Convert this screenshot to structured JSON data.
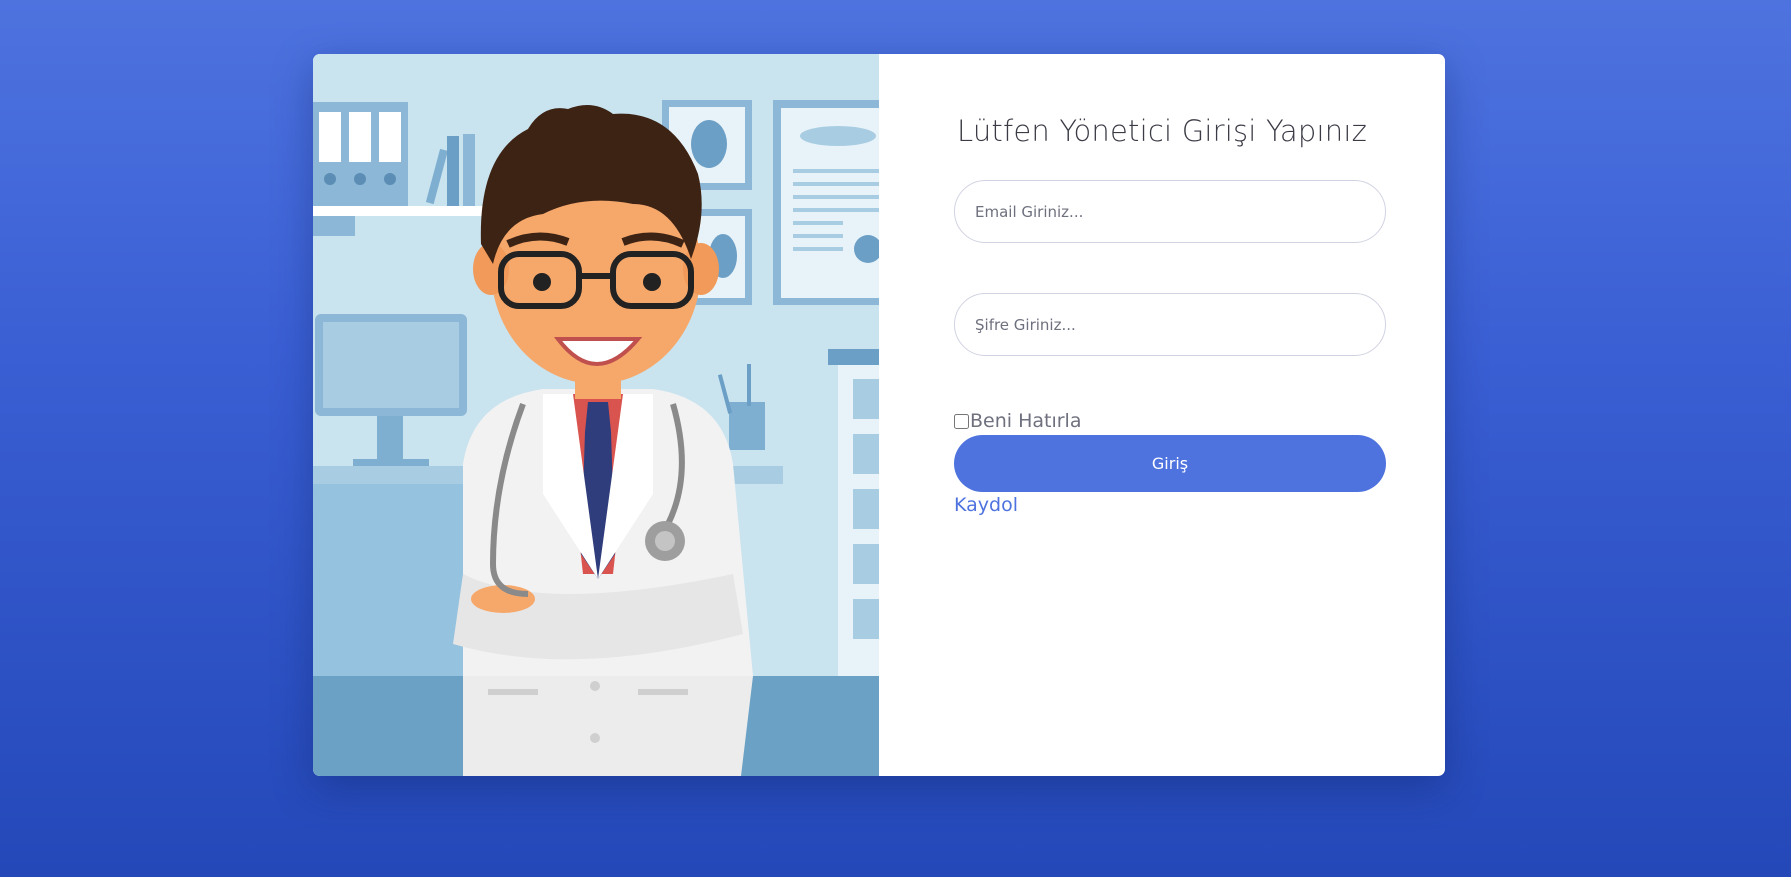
{
  "form": {
    "title": "Lütfen Yönetici Girişi Yapınız",
    "email_placeholder": "Email Giriniz...",
    "password_placeholder": "Şifre Giriniz...",
    "remember_label": "Beni Hatırla",
    "submit_label": "Giriş",
    "register_label": "Kaydol"
  },
  "illustration": {
    "icon": "doctor-illustration"
  },
  "colors": {
    "accent": "#4e73df",
    "background_top": "#4e73df",
    "background_bottom": "#2448b8"
  }
}
